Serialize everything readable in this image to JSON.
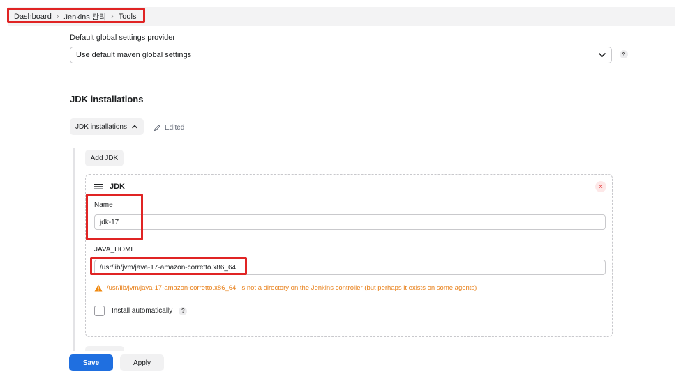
{
  "breadcrumb": {
    "items": [
      "Dashboard",
      "Jenkins 관리",
      "Tools"
    ]
  },
  "maven": {
    "label": "Default global settings provider",
    "selected": "Use default maven global settings",
    "help": "?"
  },
  "jdk_section": {
    "title": "JDK installations",
    "toggle_label": "JDK installations",
    "edited_label": "Edited",
    "add_label": "Add JDK"
  },
  "jdk": {
    "header": "JDK",
    "close": "×",
    "name_label": "Name",
    "name_value": "jdk-17",
    "java_home_label": "JAVA_HOME",
    "java_home_value": "/usr/lib/jvm/java-17-amazon-corretto.x86_64",
    "warning_path": "/usr/lib/jvm/java-17-amazon-corretto.x86_64",
    "warning_text": "is not a directory on the Jenkins controller (but perhaps it exists on some agents)",
    "install_label": "Install automatically",
    "install_help": "?"
  },
  "footer": {
    "save_label": "Save",
    "apply_label": "Apply"
  },
  "colors": {
    "accent": "#1f6fe0",
    "warning": "#e8801a",
    "highlight": "#e02424"
  }
}
